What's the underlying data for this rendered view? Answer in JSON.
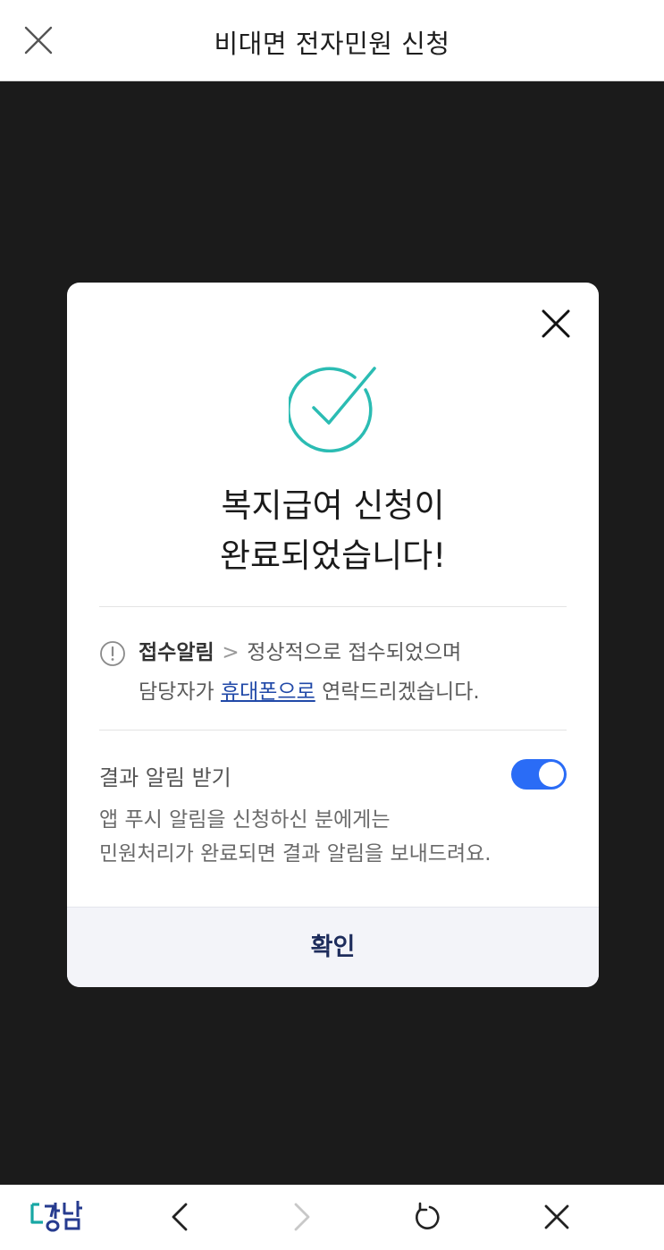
{
  "header": {
    "title": "비대면 전자민원 신청"
  },
  "modal": {
    "heading_line1": "복지급여 신청이",
    "heading_line2": "완료되었습니다!",
    "notice": {
      "label": "접수알림",
      "chevron": ">",
      "text_part1": "정상적으로 접수되었으며",
      "text_part2_prefix": "담당자가",
      "link": "휴대폰으로",
      "text_part2_suffix": "연락드리겠습니다."
    },
    "result": {
      "label": "결과 알림 받기",
      "toggle_on": true,
      "desc_line1": "앱 푸시 알림을 신청하신 분에게는",
      "desc_line2": "민원처리가 완료되면 결과 알림을 보내드려요."
    },
    "confirm_label": "확인"
  },
  "bottom_bar": {
    "logo_text": "강남"
  },
  "colors": {
    "overlay": "#1b1b1b",
    "success_teal": "#2bbcb3",
    "toggle_blue": "#2a6cf6",
    "link_blue": "#2149a8",
    "confirm_text": "#1d2c5c",
    "logo_teal": "#17a7a4",
    "logo_navy": "#263b8f"
  },
  "icons": {
    "header_close": "close-icon",
    "modal_close": "close-icon",
    "success": "check-circle-icon",
    "notice": "exclamation-circle-icon",
    "nav_back": "chevron-left-icon",
    "nav_forward": "chevron-right-icon",
    "nav_refresh": "refresh-icon",
    "nav_close": "close-icon"
  }
}
